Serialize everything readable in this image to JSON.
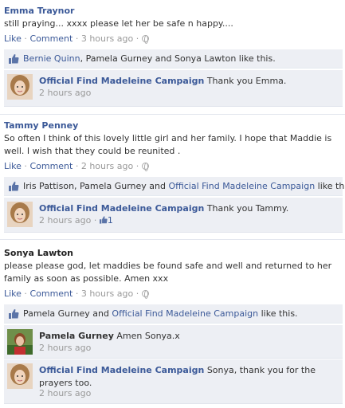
{
  "comments": [
    {
      "author": "Emma Traynor",
      "text": "still praying... xxxx please let her be safe n happy....",
      "like_label": "Like",
      "comment_label": "Comment",
      "time": "3 hours ago",
      "likes_text": {
        "names": "Bernie Quinn",
        "rest": ", Pamela Gurney and Sonya Lawton like this."
      },
      "replies": [
        {
          "author": "Official Find Madeleine Campaign",
          "text": "Thank you Emma.",
          "time": "2 hours ago"
        }
      ]
    },
    {
      "author": "Tammy Penney",
      "text": "So often I think of this lovely little girl and her family. I hope that Maddie is well. I wish that they could be reunited .",
      "like_label": "Like",
      "comment_label": "Comment",
      "time": "2 hours ago",
      "likes_text": {
        "names": "Iris Pattison, Pamela Gurney and ",
        "link": "Official Find Madeleine Campaign",
        "rest": " like this."
      },
      "replies": [
        {
          "author": "Official Find Madeleine Campaign",
          "text": "Thank you Tammy.",
          "time": "2 hours ago",
          "like_count": "1"
        }
      ]
    },
    {
      "author": "Sonya Lawton",
      "text": "please please god, let maddies be found safe and well and returned to her family as soon as possible. Amen xxx",
      "like_label": "Like",
      "comment_label": "Comment",
      "time": "3 hours ago",
      "likes_text": {
        "names": "Pamela Gurney and ",
        "link": "Official Find Madeleine Campaign",
        "rest": " like this."
      },
      "replies": [
        {
          "author": "Pamela Gurney",
          "text": "Amen Sonya.x",
          "time": "2 hours ago"
        },
        {
          "author": "Official Find Madeleine Campaign",
          "text": "Sonya, thank you for the prayers too.",
          "time": "2 hours ago"
        }
      ]
    }
  ],
  "separator": " · ",
  "colors": {
    "link": "#3b5998",
    "reply_bg": "#edeff4",
    "meta": "#999999"
  }
}
